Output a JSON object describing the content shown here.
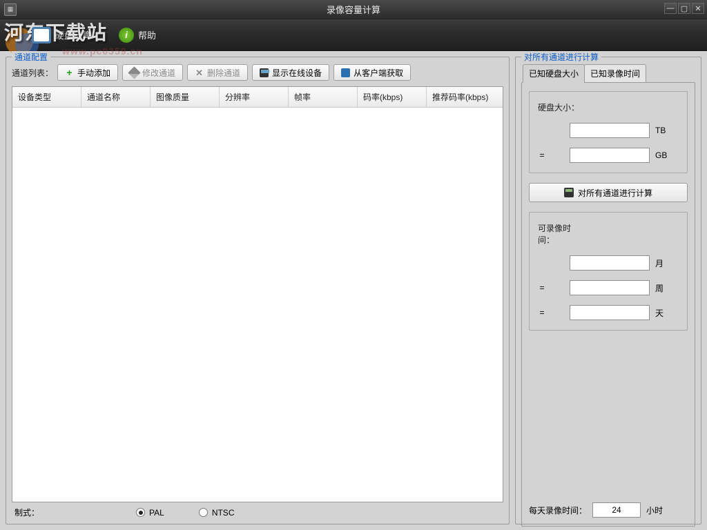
{
  "window": {
    "title": "录像容量计算"
  },
  "menubar": {
    "disk_calc": "硬盘计算",
    "help": "帮助",
    "help_icon_text": "i"
  },
  "watermark": {
    "text": "河东下载站",
    "url": "www.pc0359.cn"
  },
  "left": {
    "group_title": "通道配置",
    "list_label": "通道列表：",
    "btn_add": "手动添加",
    "btn_edit": "修改通道",
    "btn_delete": "删除通道",
    "btn_show_online": "显示在线设备",
    "btn_from_client": "从客户端获取",
    "columns": [
      "设备类型",
      "通道名称",
      "图像质量",
      "分辨率",
      "帧率",
      "码率(kbps)",
      "推荐码率(kbps)"
    ],
    "format_label": "制式：",
    "format_options": {
      "pal": "PAL",
      "ntsc": "NTSC"
    },
    "format_selected": "pal"
  },
  "right": {
    "group_title": "对所有通道进行计算",
    "tabs": {
      "disk": "已知硬盘大小",
      "time": "已知录像时间"
    },
    "disk_size_label": "硬盘大小：",
    "unit_tb": "TB",
    "unit_gb": "GB",
    "calc_btn": "对所有通道进行计算",
    "record_time_label": "可录像时间：",
    "unit_month": "月",
    "unit_week": "周",
    "unit_day": "天",
    "daily_label": "每天录像时间：",
    "daily_value": "24",
    "daily_unit": "小时",
    "eq": "="
  }
}
